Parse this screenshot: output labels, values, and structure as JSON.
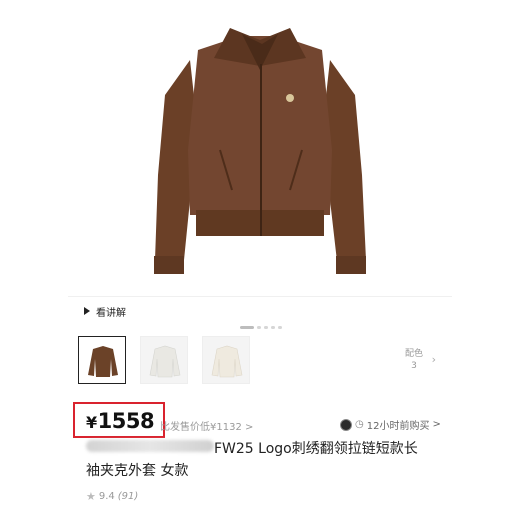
{
  "product": {
    "explain_label": "看讲解",
    "color_label": "配色",
    "color_count": "3",
    "price_symbol": "¥",
    "price_value": "1558",
    "ref_price": "比发售价低¥1132",
    "ref_chevron": ">",
    "recent_purchase": "12小时前购买",
    "recent_chevron": ">",
    "title_line1": "FW25 Logo刺绣翻领拉链短款长",
    "title_line2": "袖夹克外套 女款",
    "rating_value": "9.4",
    "rating_count": "(91)"
  },
  "thumbnails": [
    {
      "color": "#6b4228",
      "selected": true
    },
    {
      "color": "#f1f0ec",
      "selected": false
    },
    {
      "color": "#f3efe6",
      "selected": false
    }
  ],
  "colors": {
    "jacket": "#6e4329",
    "price_highlight": "#d9232e"
  }
}
